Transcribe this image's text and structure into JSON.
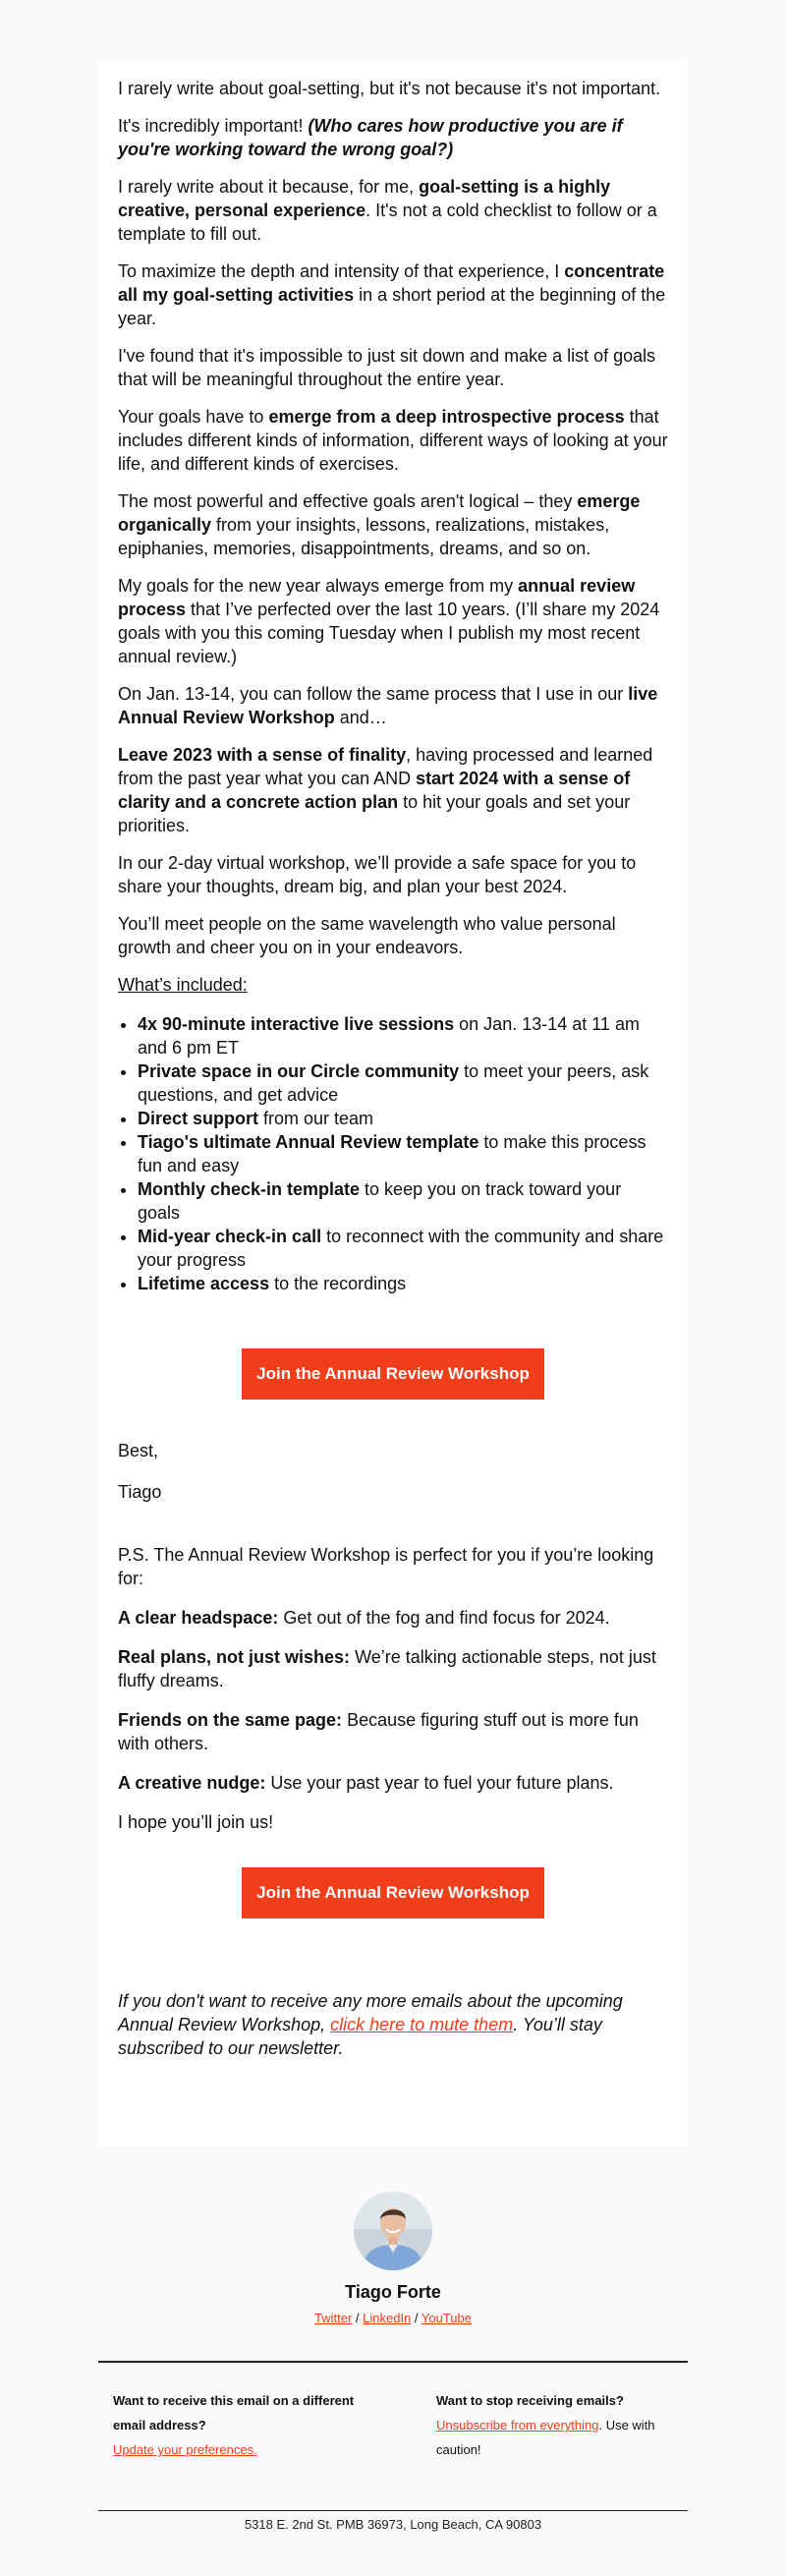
{
  "intro": {
    "p1": "I rarely write about goal-setting, but it's not because it's not important.",
    "p2a": "It's incredibly important! ",
    "p2b": "(Who cares how productive you are if you're working toward the wrong goal?)",
    "p3a": "I rarely write about it because, for me, ",
    "p3b": "goal-setting is a highly creative, personal experience",
    "p3c": ". It's not a cold checklist to follow or a template to fill out.",
    "p4a": "To maximize the depth and intensity of that experience, I ",
    "p4b": "concentrate all my goal-setting activities",
    "p4c": " in a short period at the beginning of the year.",
    "p5": "I've found that it's impossible to just sit down and make a list of goals that will be meaningful throughout the entire year.",
    "p6a": "Your goals have to ",
    "p6b": "emerge from a deep introspective process",
    "p6c": " that includes different kinds of information, different ways of looking at your life, and different kinds of exercises.",
    "p7a": "The most powerful and effective goals aren't logical – they ",
    "p7b": "emerge organically",
    "p7c": " from your insights, lessons, realizations, mistakes, epiphanies, memories, disappointments, dreams, and so on.",
    "p8a": "My goals for the new year always emerge from my ",
    "p8b": "annual review process",
    "p8c": " that I’ve perfected over the last 10 years. (I’ll share my 2024 goals with you this coming Tuesday when I publish my most recent annual review.)",
    "p9a": "On Jan. 13-14, you can follow the same process that I use in our ",
    "p9b": "live Annual Review Workshop",
    "p9c": " and…",
    "p10a": "Leave 2023 with a sense of finality",
    "p10b": ", having processed and learned from the past year what you can AND ",
    "p10c": "start 2024 with a sense of clarity and a concrete action plan",
    "p10d": " to hit your goals and set your priorities.",
    "p11": "In our 2-day virtual workshop, we’ll provide a safe space for you to share your thoughts, dream big, and plan your best 2024.",
    "p12": "You’ll meet people on the same wavelength who value personal growth and cheer you on in your endeavors."
  },
  "included": {
    "heading": "What’s included:",
    "items": [
      {
        "bold": "4x 90-minute interactive live sessions",
        "rest": " on Jan. 13-14 at 11 am and 6 pm ET"
      },
      {
        "bold": "Private space in our Circle community",
        "rest": " to meet your peers, ask questions, and get advice"
      },
      {
        "bold": "Direct support",
        "rest": " from our team"
      },
      {
        "bold": "Tiago's ultimate Annual Review template",
        "rest": " to make this process fun and easy"
      },
      {
        "bold": "Monthly check-in template",
        "rest": " to keep you on track toward your goals"
      },
      {
        "bold": "Mid-year check-in call",
        "rest": " to reconnect with the community and share your progress"
      },
      {
        "bold": "Lifetime access",
        "rest": " to the recordings"
      }
    ]
  },
  "cta_label": "Join the Annual Review Workshop",
  "signoff": {
    "best": "Best,",
    "name": "Tiago"
  },
  "ps": {
    "intro": "P.S. The Annual Review Workshop is perfect for you if you’re looking for:",
    "items": [
      {
        "bold": "A clear headspace:",
        "rest": " Get out of the fog and find focus for 2024."
      },
      {
        "bold": "Real plans, not just wishes:",
        "rest": " We’re talking actionable steps, not just fluffy dreams."
      },
      {
        "bold": "Friends on the same page:",
        "rest": " Because figuring stuff out is more fun with others."
      },
      {
        "bold": "A creative nudge:",
        "rest": " Use your past year to fuel your future plans."
      }
    ],
    "closing": "I hope you’ll join us!"
  },
  "mute": {
    "a": "If you don't want to receive any more emails about the upcoming Annual Review Workshop, ",
    "link": "click here to mute them",
    "b": ". You’ll stay subscribed to our newsletter."
  },
  "footer": {
    "name": "Tiago Forte",
    "twitter": "Twitter",
    "linkedin": "LinkedIn",
    "youtube": "YouTube",
    "sep": " / ",
    "left_title": "Want to receive this email on a different email address?",
    "left_link": "Update your preferences.",
    "right_title": "Want to stop receiving emails?",
    "right_link": "Unsubscribe from everything",
    "right_rest": ". Use with caution!",
    "address": "5318 E. 2nd St. PMB 36973, Long Beach, CA 90803"
  },
  "colors": {
    "accent": "#f13d1a",
    "background": "#f9f9f9",
    "card": "#ffffff"
  }
}
